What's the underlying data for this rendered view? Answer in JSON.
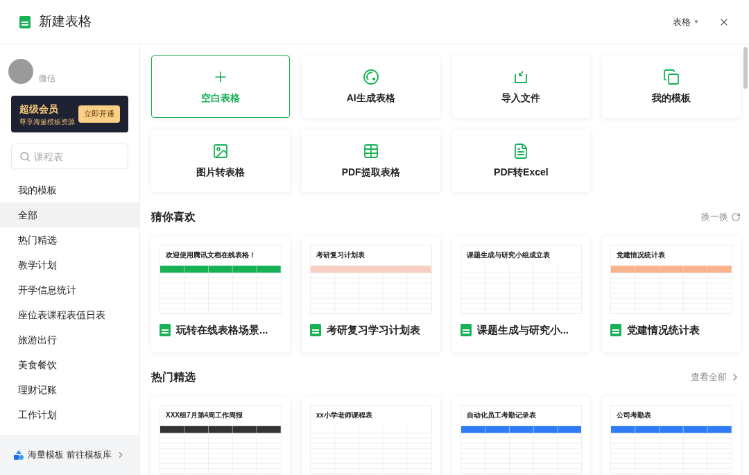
{
  "window": {
    "title": "新建表格",
    "type_menu": "表格",
    "type_caret": "▼"
  },
  "user": {
    "source": "微信"
  },
  "vip": {
    "title": "超级会员",
    "subtitle": "尊享海量模板资源",
    "button": "立即开通"
  },
  "search": {
    "placeholder": "课程表"
  },
  "sidebar": {
    "items": [
      {
        "label": "我的模板",
        "selected": false
      },
      {
        "label": "全部",
        "selected": true
      },
      {
        "label": "热门精选",
        "selected": false
      },
      {
        "label": "教学计划",
        "selected": false
      },
      {
        "label": "开学信息统计",
        "selected": false
      },
      {
        "label": "座位表课程表值日表",
        "selected": false
      },
      {
        "label": "旅游出行",
        "selected": false
      },
      {
        "label": "美食餐饮",
        "selected": false
      },
      {
        "label": "理财记账",
        "selected": false
      },
      {
        "label": "工作计划",
        "selected": false
      }
    ],
    "footer": "海量模板 前往模板库"
  },
  "actions": [
    {
      "kind": "plus",
      "label": "空白表格",
      "selected": true
    },
    {
      "kind": "ai",
      "label": "AI生成表格",
      "selected": false
    },
    {
      "kind": "import",
      "label": "导入文件",
      "selected": false
    },
    {
      "kind": "templates",
      "label": "我的模板",
      "selected": false
    },
    {
      "kind": "image",
      "label": "图片转表格",
      "selected": false
    },
    {
      "kind": "table",
      "label": "PDF提取表格",
      "selected": false
    },
    {
      "kind": "pdf",
      "label": "PDF转Excel",
      "selected": false
    }
  ],
  "sections": [
    {
      "title": "猜你喜欢",
      "link": "换一换",
      "kind": "refresh",
      "templates": [
        {
          "preview_title": "欢迎使用腾讯文档在线表格！",
          "color": "#16b155",
          "name": "玩转在线表格场景..."
        },
        {
          "preview_title": "考研复习计划表",
          "color": "#f8cfc4",
          "name": "考研复习学习计划表"
        },
        {
          "preview_title": "课题生成与研究小组成立表",
          "color": "#ffffff",
          "name": "课题生成与研究小..."
        },
        {
          "preview_title": "党建情况统计表",
          "color": "#f9b38c",
          "name": "党建情况统计表"
        }
      ]
    },
    {
      "title": "热门精选",
      "link": "查看全部",
      "kind": "chevron",
      "templates": [
        {
          "preview_title": "XXX组7月第4周工作周报",
          "color": "#333333"
        },
        {
          "preview_title": "xx小学老师课程表",
          "color": "#ffffff"
        },
        {
          "preview_title": "自动化员工考勤记录表",
          "color": "#2f7cf6"
        },
        {
          "preview_title": "公司考勤表",
          "color": "#2f7cf6"
        }
      ]
    }
  ]
}
